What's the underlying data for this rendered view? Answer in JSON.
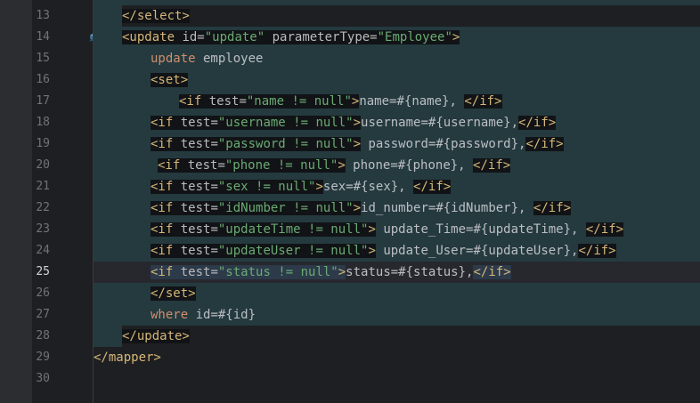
{
  "gutter": {
    "line_numbers": [
      "13",
      "14",
      "15",
      "16",
      "17",
      "18",
      "19",
      "20",
      "21",
      "22",
      "23",
      "24",
      "25",
      "26",
      "27",
      "28",
      "29",
      "30"
    ],
    "current_line": "25",
    "gutter_icon": "mybatis-bird-icon"
  },
  "colors": {
    "background": "#1e1f22",
    "tag": "#d5b778",
    "attribute": "#bababa",
    "string": "#6aab73",
    "keyword": "#cf8e6d",
    "text": "#bcbec4",
    "highlight": "#243a3f"
  },
  "code": {
    "l13": {
      "close_select": "</select>"
    },
    "l14": {
      "open": "<update",
      "attr1": " id=",
      "val1": "\"update\"",
      "attr2": " parameterType=",
      "val2": "\"Employee\"",
      "close": ">"
    },
    "l15": {
      "kw": "update",
      "rest": " employee"
    },
    "l16": {
      "tag": "<set>"
    },
    "l17": {
      "open": "<if",
      "attr": " test=",
      "val": "\"name != null\"",
      "gt": ">",
      "text": "name=#{name}, ",
      "end": "</if>"
    },
    "l18": {
      "open": "<if",
      "attr": " test=",
      "val": "\"username != null\"",
      "gt": ">",
      "text": "username=#{username},",
      "end": "</if>"
    },
    "l19": {
      "open": "<if",
      "attr": " test=",
      "val": "\"password != null\"",
      "gt": ">",
      "text": " password=#{password},",
      "end": "</if>"
    },
    "l20": {
      "open": "<if",
      "attr": " test=",
      "val": "\"phone != null\"",
      "gt": ">",
      "text": " phone=#{phone}, ",
      "end": "</if>"
    },
    "l21": {
      "open": "<if",
      "attr": " test=",
      "val": "\"sex != null\"",
      "gt": ">",
      "text": "sex=#{sex}, ",
      "end": "</if>"
    },
    "l22": {
      "open": "<if",
      "attr": " test=",
      "val": "\"idNumber != null\"",
      "gt": ">",
      "text": "id_number=#{idNumber}, ",
      "end": "</if>"
    },
    "l23": {
      "open": "<if",
      "attr": " test=",
      "val": "\"updateTime != null\"",
      "gt": ">",
      "text": " update_Time=#{updateTime}, ",
      "end": "</if>"
    },
    "l24": {
      "open": "<if",
      "attr": " test=",
      "val": "\"updateUser != null\"",
      "gt": ">",
      "text": " update_User=#{updateUser},",
      "end": "</if>"
    },
    "l25": {
      "open": "<if",
      "attr": " test=",
      "val": "\"status != null\"",
      "gt": ">",
      "text": "status=#{status},",
      "end": "</if>"
    },
    "l26": {
      "tag": "</set>"
    },
    "l27": {
      "kw": "where",
      "rest": " id=#{id}"
    },
    "l28": {
      "tag": "</update>"
    },
    "l29": {
      "tag": "</mapper>"
    }
  }
}
